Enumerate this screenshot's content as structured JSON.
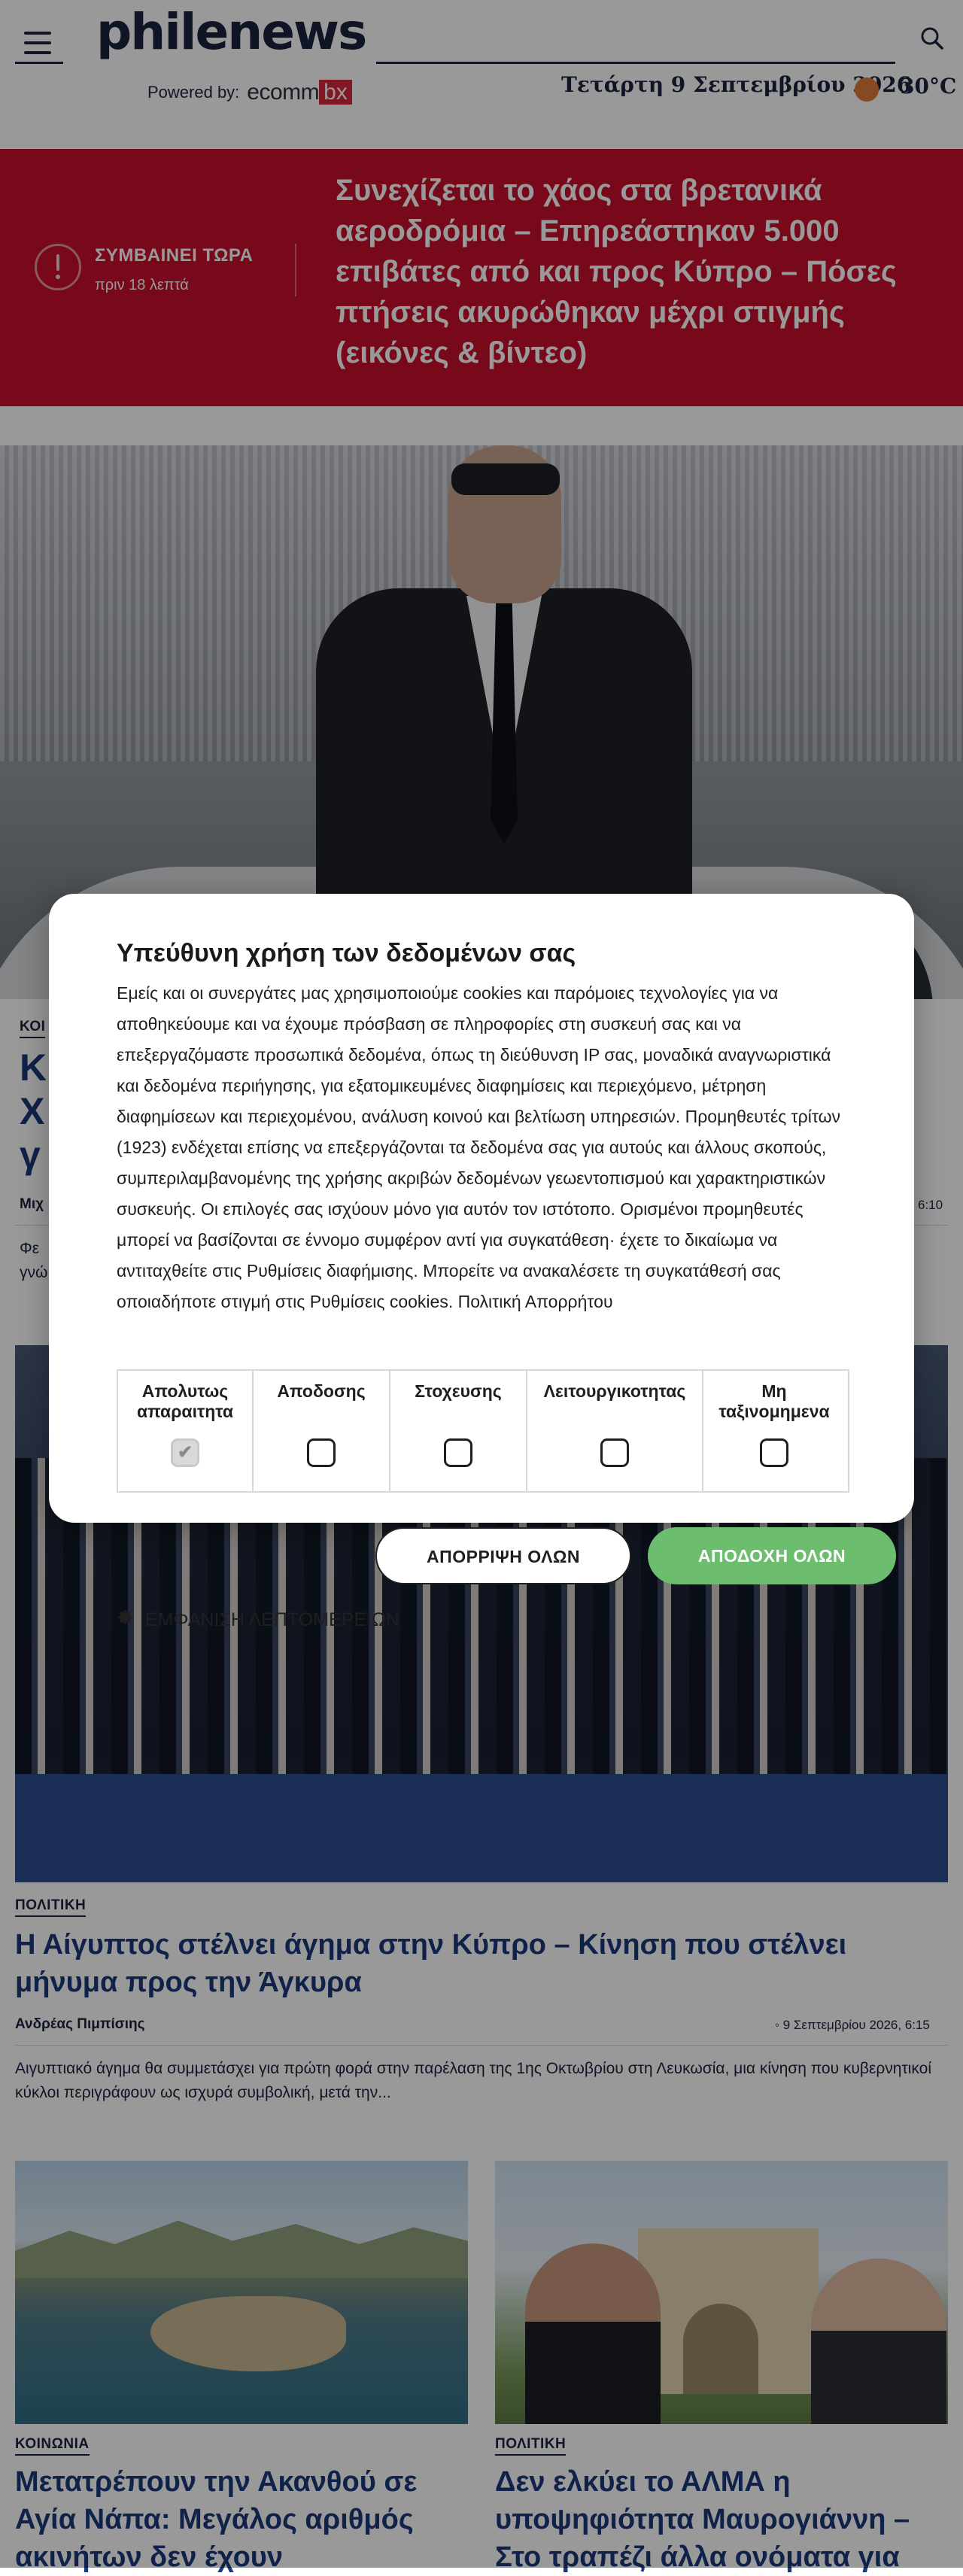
{
  "header": {
    "logo": "philenews",
    "powered_by": "Powered by:",
    "sponsor_main": "ecomm",
    "sponsor_box": "bx",
    "date": "Τετάρτη 9 Σεπτεμβρίου 2026",
    "temperature": "30°C"
  },
  "breaking": {
    "label": "ΣΥΜΒΑΙΝΕΙ ΤΩΡΑ",
    "time_ago": "πριν 18 λεπτά",
    "headline": "Συνεχίζεται το χάος στα βρετανικά αεροδρόμια – Επηρεάστηκαν 5.000 επιβάτες από και προς Κύπρο – Πόσες πτήσεις ακυρώθηκαν μέχρι στιγμής (εικόνες & βίντεο)"
  },
  "hero": {
    "category": "ΚΟΙ",
    "title_line1": "Κ",
    "title_line2": "Χ",
    "title_line3": "γ",
    "author": "Μιχ",
    "time": "6:10",
    "excerpt_line1": "Φε",
    "excerpt_line2": "γνώ"
  },
  "article2": {
    "category": "ΠΟΛΙΤΙΚΗ",
    "title": "Η Αίγυπτος στέλνει άγημα στην Κύπρο – Κίνηση που στέλνει μήνυμα προς την Άγκυρα",
    "author": "Ανδρέας Πιμπίσιης",
    "date": "9 Σεπτεμβρίου 2026, 6:15",
    "excerpt": "Αιγυπτιακό άγημα θα συμμετάσχει για πρώτη φορά στην παρέλαση της 1ης Οκτωβρίου στη Λευκωσία, μια κίνηση που κυβερνητικοί κύκλοι περιγράφουν ως ισχυρά συμβολική, μετά την..."
  },
  "cards": [
    {
      "category": "ΚΟΙΝΩΝΙΑ",
      "title": "Μετατρέπουν την Ακανθού σε Αγία Νάπα: Μεγάλος αριθμός ακινήτων δεν έχουν"
    },
    {
      "category": "ΠΟΛΙΤΙΚΗ",
      "title": "Δεν ελκύει το ΑΛΜΑ η υποψηφιότητα Μαυρογιάννη – Στο τραπέζι άλλα ονόματα για"
    }
  ],
  "cookie_modal": {
    "title": "Υπεύθυνη χρήση των δεδομένων σας",
    "body": "Εμείς και οι συνεργάτες μας χρησιμοποιούμε cookies και παρόμοιες τεχνολογίες για να αποθηκεύουμε και να έχουμε πρόσβαση σε πληροφορίες στη συσκευή σας και να επεξεργαζόμαστε προσωπικά δεδομένα, όπως τη διεύθυνση IP σας, μοναδικά αναγνωριστικά και δεδομένα περιήγησης, για εξατομικευμένες διαφημίσεις και περιεχόμενο, μέτρηση διαφημίσεων και περιεχομένου, ανάλυση κοινού και βελτίωση υπηρεσιών. Προμηθευτές τρίτων (1923) ενδέχεται επίσης να επεξεργάζονται τα δεδομένα σας για αυτούς και άλλους σκοπούς, συμπεριλαμβανομένης της χρήσης ακριβών δεδομένων γεωεντοπισμού και χαρακτηριστικών συσκευής. Οι επιλογές σας ισχύουν μόνο για αυτόν τον ιστότοπο. Ορισμένοι προμηθευτές μπορεί να βασίζονται σε έννομο συμφέρον αντί για συγκατάθεση· έχετε το δικαίωμα να αντιταχθείτε στις Ρυθμίσεις διαφήμισης. Μπορείτε να ανακαλέσετε τη συγκατάθεσή σας οποιαδήποτε στιγμή στις Ρυθμίσεις cookies. Πολιτική Απορρήτου",
    "categories": [
      {
        "label": "Απολυτως απαραιτητα",
        "checked": true
      },
      {
        "label": "Αποδοσης",
        "checked": false
      },
      {
        "label": "Στοχευσης",
        "checked": false
      },
      {
        "label": "Λειτουργικοτητας",
        "checked": false
      },
      {
        "label": "Μη ταξινομημενα",
        "checked": false
      }
    ],
    "reject_label": "ΑΠΟΡΡΙΨΗ ΟΛΩΝ",
    "accept_label": "ΑΠΟΔΟΧΗ ΟΛΩΝ",
    "details_label": "ΕΜΦΑΝΙΣΗ ΛΕΠΤΟΜΕΡΕΙΩΝ",
    "accept_color": "#6cbd6e"
  },
  "colors": {
    "brand_navy": "#1b2440",
    "breaking_red": "#c8102e",
    "headline_blue": "#1b3a7a"
  }
}
